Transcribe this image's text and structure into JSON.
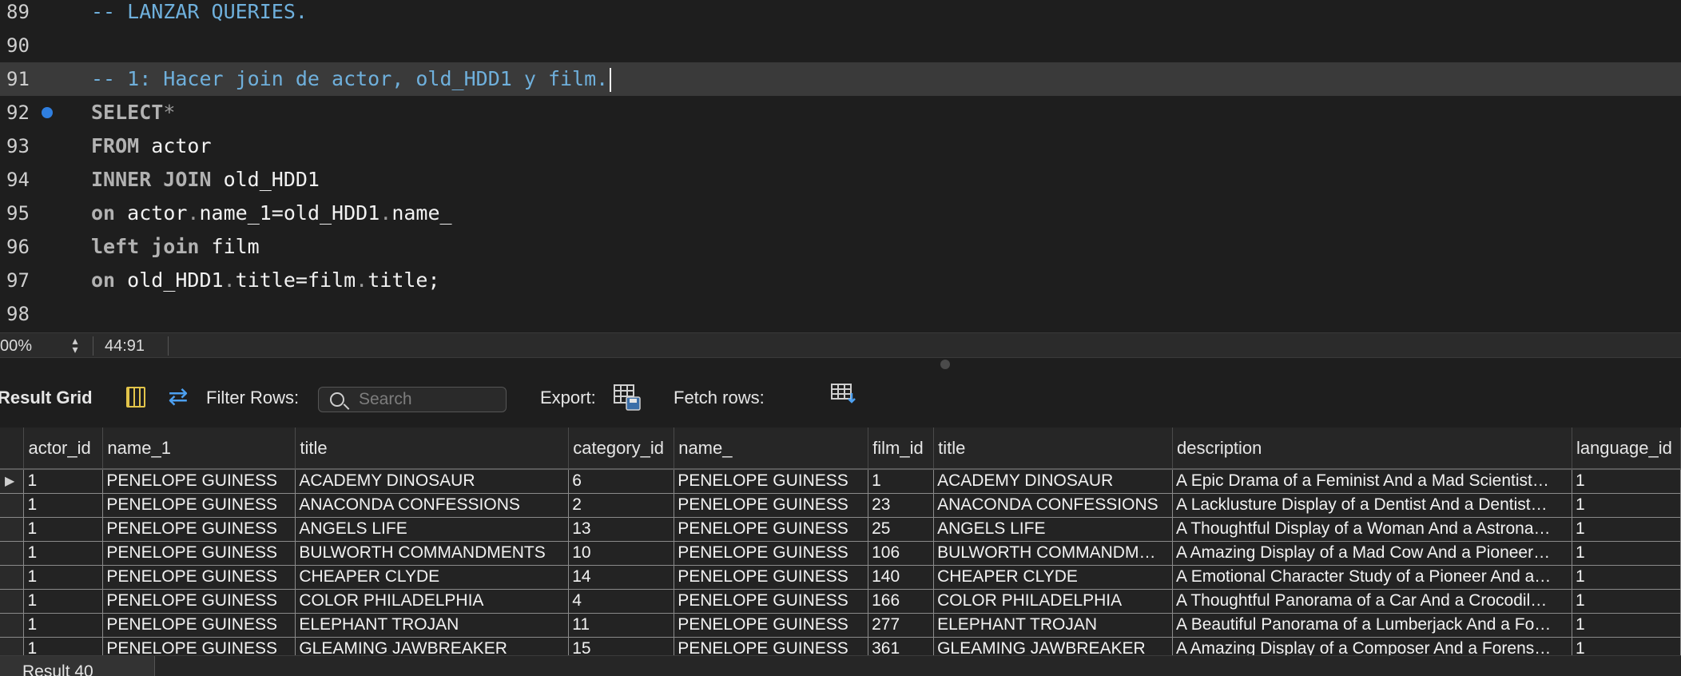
{
  "editor": {
    "lines": [
      {
        "num": "89",
        "tokens": [
          {
            "t": "-- LANZAR QUERIES.",
            "c": "comment"
          }
        ]
      },
      {
        "num": "90",
        "tokens": []
      },
      {
        "num": "91",
        "highlight": true,
        "cursor": true,
        "tokens": [
          {
            "t": "-- 1: Hacer join de actor, old_HDD1 y film.",
            "c": "comment"
          }
        ]
      },
      {
        "num": "92",
        "marker": true,
        "tokens": [
          {
            "t": "SELECT",
            "c": "kw"
          },
          {
            "t": "*",
            "c": "dot"
          }
        ]
      },
      {
        "num": "93",
        "tokens": [
          {
            "t": "FROM",
            "c": "kw"
          },
          {
            "t": " actor",
            "c": "id"
          }
        ]
      },
      {
        "num": "94",
        "tokens": [
          {
            "t": "INNER JOIN",
            "c": "kw"
          },
          {
            "t": " old_HDD1",
            "c": "id"
          }
        ]
      },
      {
        "num": "95",
        "tokens": [
          {
            "t": "on",
            "c": "kw"
          },
          {
            "t": " actor",
            "c": "id"
          },
          {
            "t": ".",
            "c": "dot"
          },
          {
            "t": "name_1=old_HDD1",
            "c": "id"
          },
          {
            "t": ".",
            "c": "dot"
          },
          {
            "t": "name_",
            "c": "id"
          }
        ]
      },
      {
        "num": "96",
        "tokens": [
          {
            "t": "left join",
            "c": "kw"
          },
          {
            "t": " film",
            "c": "id"
          }
        ]
      },
      {
        "num": "97",
        "tokens": [
          {
            "t": "on",
            "c": "kw"
          },
          {
            "t": " old_HDD1",
            "c": "id"
          },
          {
            "t": ".",
            "c": "dot"
          },
          {
            "t": "title=film",
            "c": "id"
          },
          {
            "t": ".",
            "c": "dot"
          },
          {
            "t": "title;",
            "c": "id"
          }
        ]
      },
      {
        "num": "98",
        "tokens": []
      }
    ]
  },
  "status": {
    "zoom": "00%",
    "stepper": "⌃⌄",
    "cursor_position": "44:91"
  },
  "toolbar": {
    "title": "Result Grid",
    "filter_label": "Filter Rows:",
    "search_placeholder": "Search",
    "export_label": "Export:",
    "fetch_label": "Fetch rows:"
  },
  "grid": {
    "columns": [
      "actor_id",
      "name_1",
      "title",
      "category_id",
      "name_",
      "film_id",
      "title",
      "description",
      "language_id"
    ],
    "current_row_marker": "▶",
    "rows": [
      [
        "1",
        "PENELOPE GUINESS",
        "ACADEMY DINOSAUR",
        "6",
        "PENELOPE GUINESS",
        "1",
        "ACADEMY DINOSAUR",
        "A Epic Drama of a Feminist And a Mad Scientist…",
        "1"
      ],
      [
        "1",
        "PENELOPE GUINESS",
        "ANACONDA CONFESSIONS",
        "2",
        "PENELOPE GUINESS",
        "23",
        "ANACONDA CONFESSIONS",
        "A Lacklusture Display of a Dentist And a Dentist…",
        "1"
      ],
      [
        "1",
        "PENELOPE GUINESS",
        "ANGELS LIFE",
        "13",
        "PENELOPE GUINESS",
        "25",
        "ANGELS LIFE",
        "A Thoughtful Display of a Woman And a Astrona…",
        "1"
      ],
      [
        "1",
        "PENELOPE GUINESS",
        "BULWORTH COMMANDMENTS",
        "10",
        "PENELOPE GUINESS",
        "106",
        "BULWORTH COMMANDM…",
        "A Amazing Display of a Mad Cow And a Pioneer…",
        "1"
      ],
      [
        "1",
        "PENELOPE GUINESS",
        "CHEAPER CLYDE",
        "14",
        "PENELOPE GUINESS",
        "140",
        "CHEAPER CLYDE",
        "A Emotional Character Study of a Pioneer And a…",
        "1"
      ],
      [
        "1",
        "PENELOPE GUINESS",
        "COLOR PHILADELPHIA",
        "4",
        "PENELOPE GUINESS",
        "166",
        "COLOR PHILADELPHIA",
        "A Thoughtful Panorama of a Car And a Crocodil…",
        "1"
      ],
      [
        "1",
        "PENELOPE GUINESS",
        "ELEPHANT TROJAN",
        "11",
        "PENELOPE GUINESS",
        "277",
        "ELEPHANT TROJAN",
        "A Beautiful Panorama of a Lumberjack And a Fo…",
        "1"
      ],
      [
        "1",
        "PENELOPE GUINESS",
        "GLEAMING JAWBREAKER",
        "15",
        "PENELOPE GUINESS",
        "361",
        "GLEAMING JAWBREAKER",
        "A Amazing Display of a Composer And a Forens…",
        "1"
      ]
    ]
  },
  "bottom": {
    "result_tab": "Result 40"
  }
}
